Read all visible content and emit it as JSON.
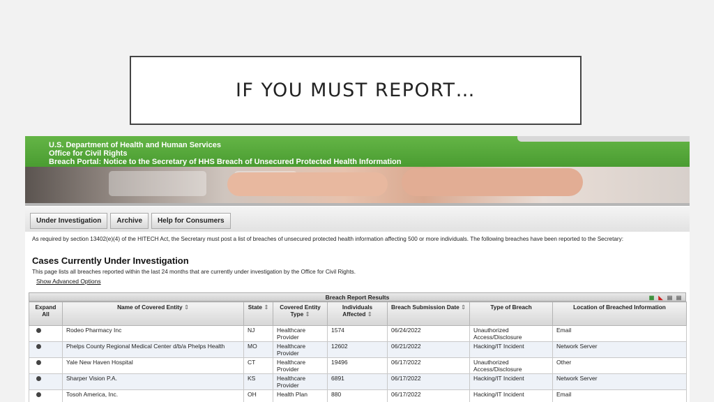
{
  "slide": {
    "title": "IF YOU MUST REPORT…"
  },
  "banner": {
    "line1": "U.S. Department of Health and Human Services",
    "line2": "Office for Civil Rights",
    "line3": "Breach Portal: Notice to the Secretary of HHS Breach of Unsecured Protected Health Information"
  },
  "nav": {
    "tabs": [
      "Under Investigation",
      "Archive",
      "Help for Consumers"
    ]
  },
  "content": {
    "intro": "As required by section 13402(e)(4) of the HITECH Act, the Secretary must post a list of breaches of unsecured protected health information affecting 500 or more individuals. The following breaches have been reported to the Secretary:",
    "heading": "Cases Currently Under Investigation",
    "subtext": "This page lists all breaches reported within the last 24 months that are currently under investigation by the Office for Civil Rights.",
    "advanced_link": "Show Advanced Options"
  },
  "results": {
    "caption": "Breach Report Results",
    "export_icons": [
      "excel-icon",
      "pdf-icon",
      "csv-icon",
      "xml-icon"
    ],
    "columns": [
      {
        "label": "Expand All",
        "sortable": false
      },
      {
        "label": "Name of Covered Entity",
        "sortable": true
      },
      {
        "label": "State",
        "sortable": true
      },
      {
        "label": "Covered Entity Type",
        "sortable": true
      },
      {
        "label": "Individuals Affected",
        "sortable": true
      },
      {
        "label": "Breach Submission Date",
        "sortable": true
      },
      {
        "label": "Type of Breach",
        "sortable": false
      },
      {
        "label": "Location of Breached Information",
        "sortable": false
      }
    ],
    "sort_glyph": "⇕",
    "rows": [
      [
        "Rodeo Pharmacy Inc",
        "NJ",
        "Healthcare Provider",
        "1574",
        "06/24/2022",
        "Unauthorized Access/Disclosure",
        "Email"
      ],
      [
        "Phelps County Regional Medical Center d/b/a Phelps Health",
        "MO",
        "Healthcare Provider",
        "12602",
        "06/21/2022",
        "Hacking/IT Incident",
        "Network Server"
      ],
      [
        "Yale New Haven Hospital",
        "CT",
        "Healthcare Provider",
        "19496",
        "06/17/2022",
        "Unauthorized Access/Disclosure",
        "Other"
      ],
      [
        "Sharper Vision P.A.",
        "KS",
        "Healthcare Provider",
        "6891",
        "06/17/2022",
        "Hacking/IT Incident",
        "Network Server"
      ],
      [
        "Tosoh America, Inc.",
        "OH",
        "Health Plan",
        "880",
        "06/17/2022",
        "Hacking/IT Incident",
        "Email"
      ]
    ]
  },
  "colors": {
    "banner_green": "#5aac3c",
    "row_alt": "#eef2f8",
    "title_border": "#444444"
  }
}
